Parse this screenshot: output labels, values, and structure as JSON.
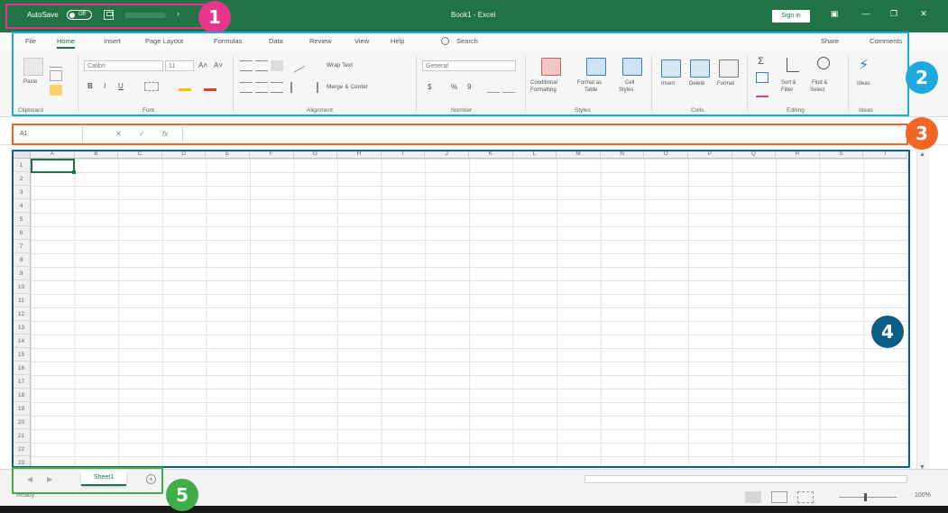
{
  "titlebar": {
    "autosave_label": "AutoSave",
    "autosave_state": "Off",
    "document_title": "Book1 - Excel",
    "signin_label": "Sign in",
    "min_glyph": "—",
    "restore_glyph": "❐",
    "close_glyph": "✕",
    "ribbon_display_glyph": "▣",
    "qa_chevron": "›"
  },
  "tabs": [
    "File",
    "Home",
    "Insert",
    "Page Layout",
    "Formulas",
    "Data",
    "Review",
    "View",
    "Help"
  ],
  "active_tab": "Home",
  "search_label": "Search",
  "share_label": "Share",
  "comments_label": "Comments",
  "ribbon": {
    "clipboard": {
      "label": "Clipboard",
      "paste_label": "Paste"
    },
    "font": {
      "label": "Font",
      "font_name": "Calibri",
      "font_size": "11",
      "bold": "B",
      "italic": "I",
      "underline": "U",
      "grow": "A˄",
      "shrink": "A˅"
    },
    "alignment": {
      "label": "Alignment",
      "wrap_text": "Wrap Text",
      "merge_center": "Merge & Center"
    },
    "number": {
      "label": "Number",
      "format": "General",
      "currency": "$",
      "percent": "%",
      "comma": "9"
    },
    "styles": {
      "label": "Styles",
      "conditional": "Conditional",
      "conditional_2": "Formatting",
      "format_table": "Format as",
      "format_table_2": "Table",
      "cell_styles": "Cell",
      "cell_styles_2": "Styles"
    },
    "cells": {
      "label": "Cells",
      "insert": "Insert",
      "delete": "Delete",
      "format": "Format"
    },
    "editing": {
      "label": "Editing",
      "sort_filter": "Sort &",
      "sort_filter_2": "Filter",
      "find_select": "Find &",
      "find_select_2": "Select"
    },
    "ideas": {
      "label": "Ideas",
      "btn": "Ideas"
    }
  },
  "formula_bar": {
    "name_box": "A1",
    "cancel": "✕",
    "enter": "✓",
    "fx": "fx"
  },
  "grid": {
    "columns": [
      "A",
      "B",
      "C",
      "D",
      "E",
      "F",
      "G",
      "H",
      "I",
      "J",
      "K",
      "L",
      "M",
      "N",
      "O",
      "P",
      "Q",
      "R",
      "S",
      "T"
    ],
    "rows": [
      "1",
      "2",
      "3",
      "4",
      "5",
      "6",
      "7",
      "8",
      "9",
      "10",
      "11",
      "12",
      "13",
      "14",
      "15",
      "16",
      "17",
      "18",
      "19",
      "20",
      "21",
      "22",
      "23"
    ]
  },
  "sheets": {
    "active": "Sheet1",
    "add": "+",
    "prev": "◀",
    "next": "▶"
  },
  "status": {
    "ready": "Ready",
    "zoom": "100%"
  },
  "callouts": [
    {
      "number": "1",
      "color": "#e8358a"
    },
    {
      "number": "2",
      "color": "#1ea8e0"
    },
    {
      "number": "3",
      "color": "#f26522"
    },
    {
      "number": "4",
      "color": "#0d5e86"
    },
    {
      "number": "5",
      "color": "#3fae49"
    }
  ],
  "colors": {
    "excel_green": "#217346",
    "pink": "#e8358a",
    "cyan": "#1ea8e0",
    "orange": "#f26522",
    "navy": "#0d5e86",
    "green": "#3fae49"
  }
}
